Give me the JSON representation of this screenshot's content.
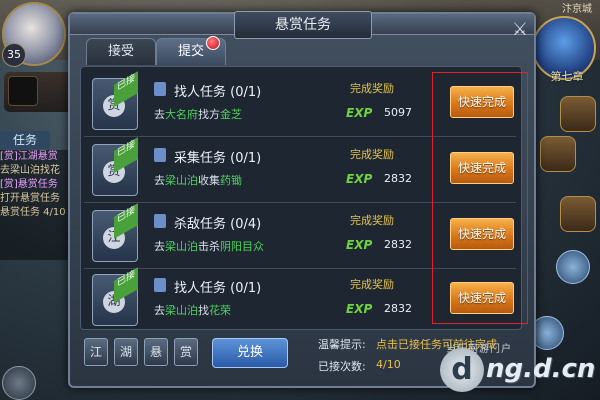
{
  "hud": {
    "player_level": "35",
    "map_name": "汴京城",
    "chapter": "第七章",
    "left_tab": "任务",
    "log_lines": [
      "[赏]江湖悬赏",
      "去梁山泊找花",
      "[赏]悬赏任务",
      "打开悬赏任务",
      "悬赏任务 4/10"
    ]
  },
  "dialog": {
    "title": "悬赏任务",
    "tabs": [
      {
        "label": "接受",
        "active": false
      },
      {
        "label": "提交",
        "active": true,
        "has_notification": true
      }
    ],
    "tasks": [
      {
        "status_ribbon": "已接",
        "glyph": "赏",
        "name": "找人任务 (0/1)",
        "desc_go": "去",
        "desc_place": "大名府",
        "desc_action": "找方",
        "desc_target": "金芝",
        "reward_label": "完成奖励",
        "exp_label": "EXP",
        "exp_value": "5097",
        "button": "快速完成"
      },
      {
        "status_ribbon": "已接",
        "glyph": "赏",
        "name": "采集任务 (0/1)",
        "desc_go": "去",
        "desc_place": "梁山泊",
        "desc_action": "收集",
        "desc_target": "药锄",
        "reward_label": "完成奖励",
        "exp_label": "EXP",
        "exp_value": "2832",
        "button": "快速完成"
      },
      {
        "status_ribbon": "已接",
        "glyph": "江",
        "name": "杀敌任务 (0/4)",
        "desc_go": "去",
        "desc_place": "梁山泊",
        "desc_action": "击杀",
        "desc_target": "阴阳目众",
        "reward_label": "完成奖励",
        "exp_label": "EXP",
        "exp_value": "2832",
        "button": "快速完成"
      },
      {
        "status_ribbon": "已接",
        "glyph": "湖",
        "name": "找人任务 (0/1)",
        "desc_go": "去",
        "desc_place": "梁山泊",
        "desc_action": "找",
        "desc_target": "花荣",
        "reward_label": "完成奖励",
        "exp_label": "EXP",
        "exp_value": "2832",
        "button": "快速完成"
      }
    ],
    "bottom": {
      "tiles": [
        "江",
        "湖",
        "悬",
        "赏"
      ],
      "exchange_button": "兑换",
      "tip_label": "温馨提示:",
      "tip_text": "点击已接任务可前往完成",
      "count_label": "已接次数:",
      "count_value": "4/10"
    }
  },
  "watermark": {
    "top": "当乐网游门户",
    "logo": "d",
    "site": "ng.d.cn"
  },
  "colors": {
    "accent_orange": "#e08a22",
    "highlight_red": "#e0222a",
    "reward_gold": "#e0c34d",
    "place_green": "#4fd35c"
  }
}
